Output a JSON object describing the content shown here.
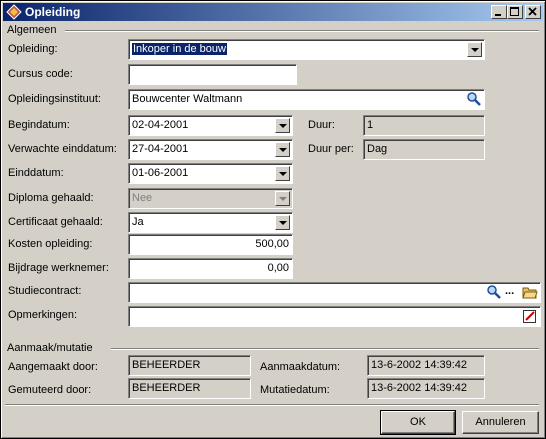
{
  "window": {
    "title": "Opleiding"
  },
  "sections": {
    "general": "Algemeen",
    "audit": "Aanmaak/mutatie"
  },
  "form": {
    "opleiding": {
      "label": "Opleiding:",
      "value": "Inkoper in de bouw"
    },
    "cursus_code": {
      "label": "Cursus code:",
      "value": ""
    },
    "instituut": {
      "label": "Opleidingsinstituut:",
      "value": "Bouwcenter Waltmann"
    },
    "begindatum": {
      "label": "Begindatum:",
      "value": "02-04-2001"
    },
    "verwachte_einddatum": {
      "label": "Verwachte einddatum:",
      "value": "27-04-2001"
    },
    "einddatum": {
      "label": "Einddatum:",
      "value": "01-06-2001"
    },
    "diploma": {
      "label": "Diploma gehaald:",
      "value": "Nee"
    },
    "certificaat": {
      "label": "Certificaat gehaald:",
      "value": "Ja"
    },
    "kosten": {
      "label": "Kosten opleiding:",
      "value": "500,00"
    },
    "bijdrage": {
      "label": "Bijdrage werknemer:",
      "value": "0,00"
    },
    "studiecontract": {
      "label": "Studiecontract:",
      "value": ""
    },
    "opmerkingen": {
      "label": "Opmerkingen:",
      "value": ""
    },
    "duur": {
      "label": "Duur:",
      "value": "1"
    },
    "duur_per": {
      "label": "Duur per:",
      "value": "Dag"
    }
  },
  "audit": {
    "aangemaakt_door": {
      "label": "Aangemaakt door:",
      "value": "BEHEERDER"
    },
    "gemuteerd_door": {
      "label": "Gemuteerd door:",
      "value": "BEHEERDER"
    },
    "aanmaakdatum": {
      "label": "Aanmaakdatum:",
      "value": "13-6-2002 14:39:42"
    },
    "mutatiedatum": {
      "label": "Mutatiedatum:",
      "value": "13-6-2002 14:39:42"
    }
  },
  "buttons": {
    "ok": "OK",
    "annuleren": "Annuleren",
    "ellipsis": "..."
  },
  "colors": {
    "titlebar": "#0a246a",
    "face": "#d4d0c8",
    "selection": "#0a246a"
  }
}
